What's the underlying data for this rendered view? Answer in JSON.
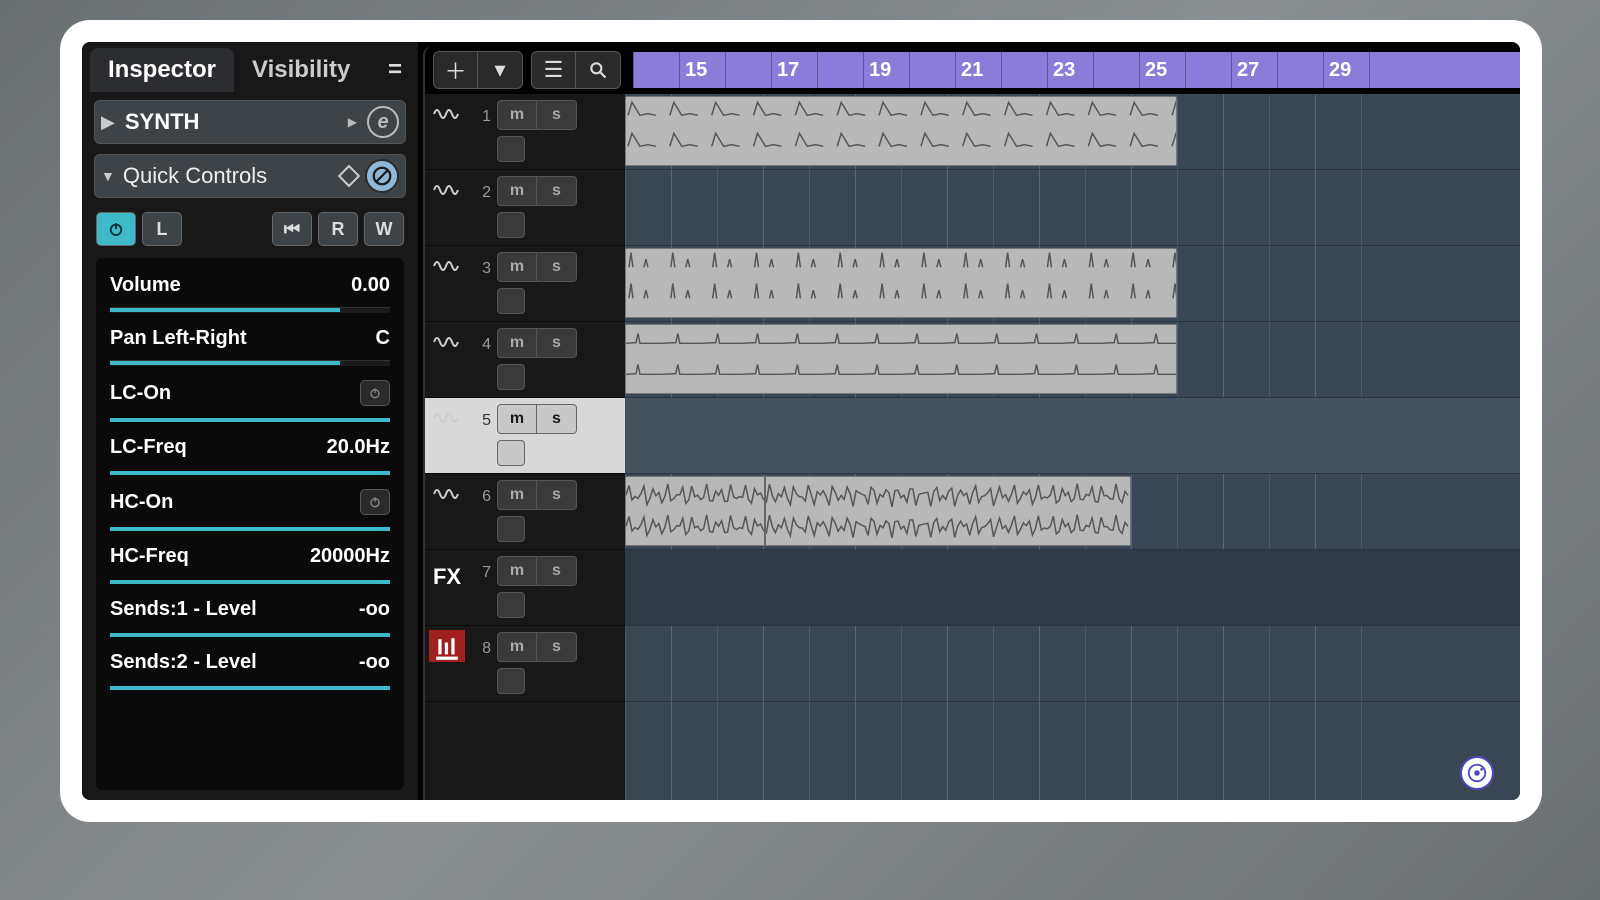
{
  "tabs": {
    "inspector": "Inspector",
    "visibility": "Visibility"
  },
  "track": {
    "name": "SYNTH"
  },
  "quick_controls": {
    "label": "Quick Controls"
  },
  "buttons": {
    "l": "L",
    "r": "R",
    "w": "W"
  },
  "params": [
    {
      "label": "Volume",
      "value": "0.00",
      "fill": 82,
      "type": "slider"
    },
    {
      "label": "Pan Left-Right",
      "value": "C",
      "fill": 82,
      "type": "slider"
    },
    {
      "label": "LC-On",
      "value": "",
      "fill": 100,
      "type": "toggle"
    },
    {
      "label": "LC-Freq",
      "value": "20.0Hz",
      "fill": 100,
      "type": "line"
    },
    {
      "label": "HC-On",
      "value": "",
      "fill": 100,
      "type": "toggle"
    },
    {
      "label": "HC-Freq",
      "value": "20000Hz",
      "fill": 100,
      "type": "line"
    },
    {
      "label": "Sends:1 - Level",
      "value": "-oo",
      "fill": 100,
      "type": "line"
    },
    {
      "label": "Sends:2 - Level",
      "value": "-oo",
      "fill": 100,
      "type": "line"
    }
  ],
  "ruler": {
    "marks": [
      15,
      17,
      19,
      21,
      23,
      25,
      27,
      29
    ]
  },
  "tracks": [
    {
      "num": 1,
      "icon": "wave",
      "selected": false,
      "ms": true
    },
    {
      "num": 2,
      "icon": "wave",
      "selected": false,
      "ms": true
    },
    {
      "num": 3,
      "icon": "wave",
      "selected": false,
      "ms": true
    },
    {
      "num": 4,
      "icon": "wave",
      "selected": false,
      "ms": true
    },
    {
      "num": 5,
      "icon": "wave",
      "selected": true,
      "ms": true
    },
    {
      "num": 6,
      "icon": "wave",
      "selected": false,
      "ms": true
    },
    {
      "num": 7,
      "icon": "fx",
      "selected": false,
      "ms": true,
      "label": "FX"
    },
    {
      "num": 8,
      "icon": "mixer",
      "selected": false,
      "ms": true,
      "red": true
    }
  ],
  "ms_labels": {
    "m": "m",
    "s": "s"
  },
  "clips": [
    {
      "track": 0,
      "startBar": 14,
      "endBar": 26,
      "pattern": "kick"
    },
    {
      "track": 2,
      "startBar": 14,
      "endBar": 26,
      "pattern": "hat"
    },
    {
      "track": 3,
      "startBar": 14,
      "endBar": 26,
      "pattern": "pad"
    },
    {
      "track": 5,
      "startBar": 14,
      "endBar": 25,
      "pattern": "noise",
      "split": 17
    }
  ],
  "grid": {
    "startBar": 14,
    "endBar": 30,
    "pxPerBar": 46
  }
}
